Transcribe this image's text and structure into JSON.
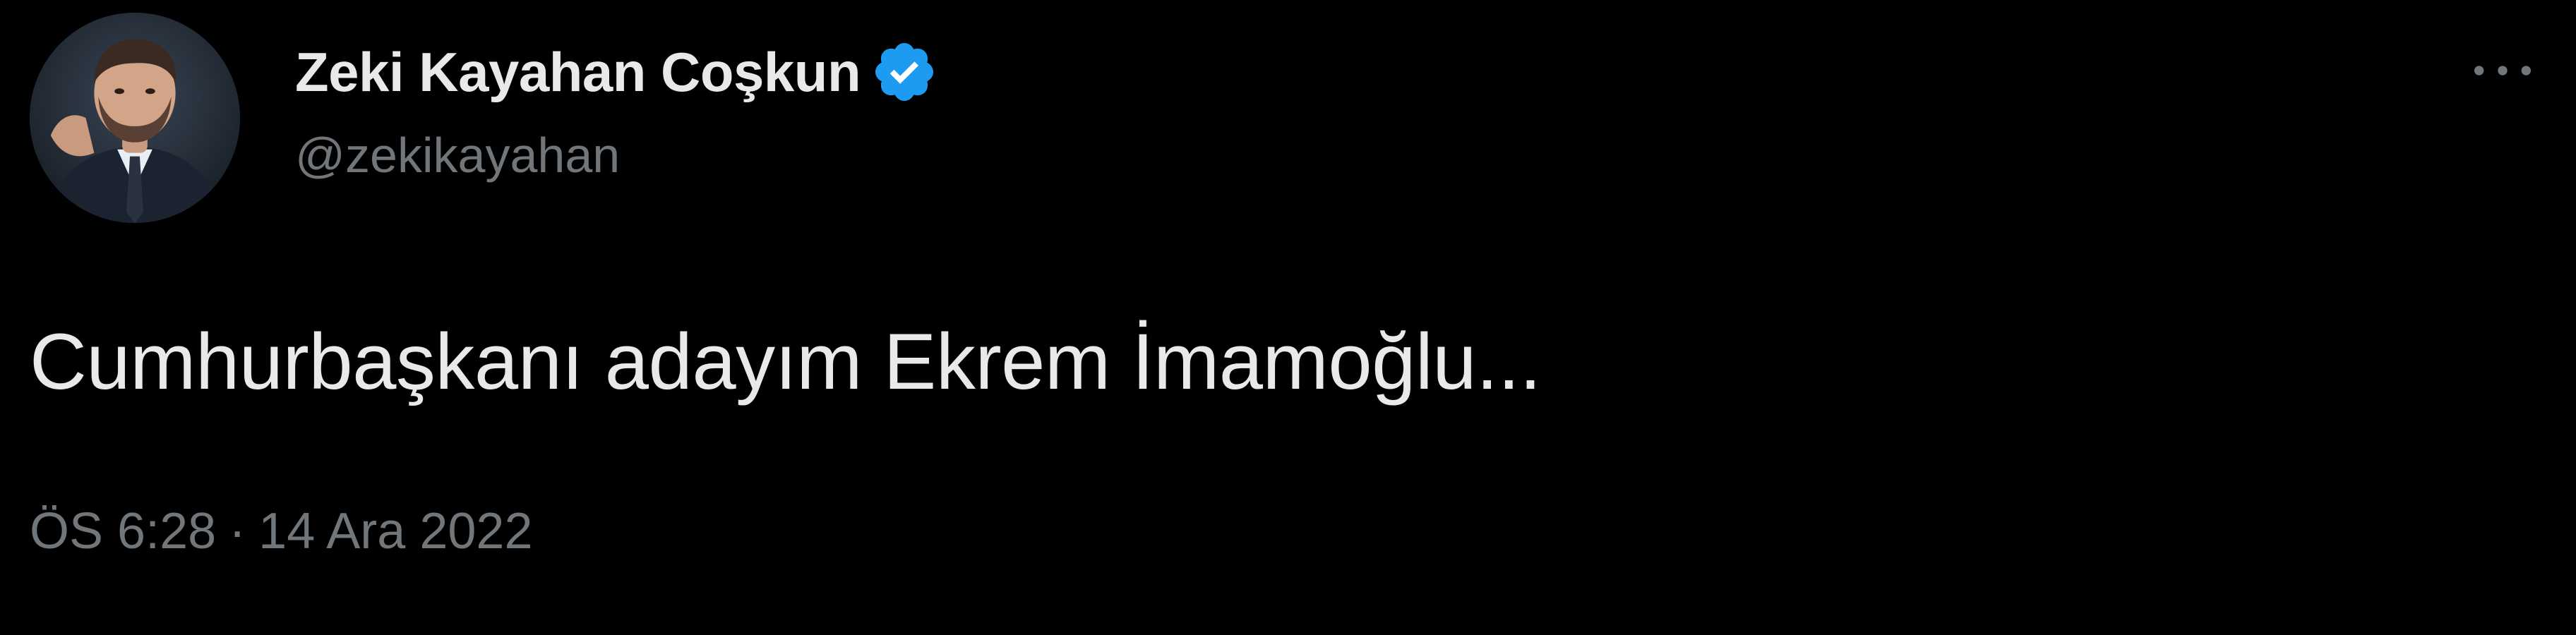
{
  "author": {
    "display_name": "Zeki Kayahan Coşkun",
    "handle": "@zekikayahan",
    "verified_icon": "verified-badge-icon",
    "avatar": "profile-photo"
  },
  "tweet": {
    "text": "Cumhurbaşkanı adayım Ekrem İmamoğlu...",
    "time": "ÖS 6:28",
    "separator": "·",
    "date": "14 Ara 2022"
  },
  "actions": {
    "more_icon": "more-options-icon"
  },
  "colors": {
    "background": "#000000",
    "primary_text": "#e7e9ea",
    "secondary_text": "#71767b",
    "verified": "#1d9bf0"
  }
}
